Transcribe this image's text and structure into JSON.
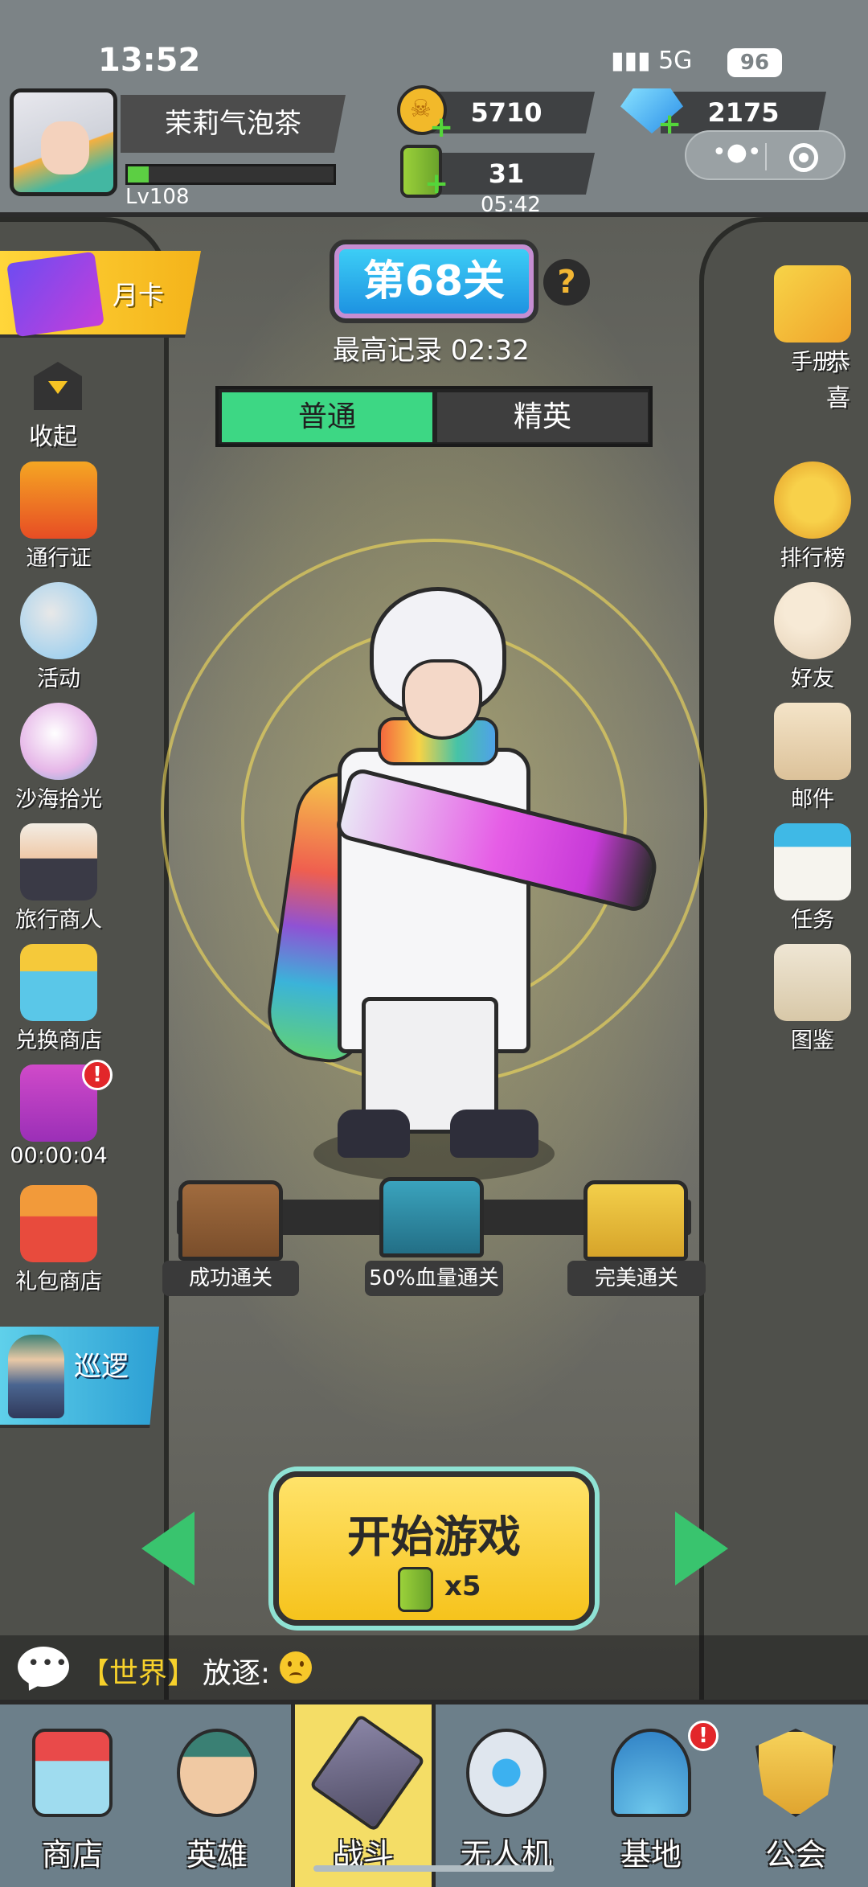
{
  "status_bar": {
    "time": "13:52",
    "network": "5G",
    "battery": "96"
  },
  "player": {
    "name": "茉莉气泡茶",
    "level": "Lv108",
    "xp_fraction": 0.1
  },
  "resources": {
    "gold": "5710",
    "gems": "2175",
    "stamina": "31",
    "stamina_timer": "05:42"
  },
  "stage": {
    "title": "第68关",
    "help": "?",
    "best_record": "最高记录 02:32",
    "modes": [
      "普通",
      "精英"
    ],
    "active_mode": "普通"
  },
  "left_menu": {
    "month_card": "月卡",
    "collapse": "收起",
    "items": [
      {
        "label": "通行证",
        "icon": "gift-box-icon"
      },
      {
        "label": "活动",
        "icon": "megaphone-icon"
      },
      {
        "label": "沙海拾光",
        "icon": "pearl-icon"
      },
      {
        "label": "旅行商人",
        "icon": "merchant-icon"
      },
      {
        "label": "兑换商店",
        "icon": "shop-icon"
      },
      {
        "label": "00:00:04",
        "icon": "timed-gift-icon",
        "badge": "!"
      },
      {
        "label": "礼包商店",
        "icon": "gift-shop-icon"
      }
    ],
    "patrol": "巡逻"
  },
  "right_menu": {
    "items": [
      {
        "label": "手册",
        "icon": "handbook-icon"
      },
      {
        "label": "排行榜",
        "icon": "trophy-icon"
      },
      {
        "label": "好友",
        "icon": "friends-icon"
      },
      {
        "label": "邮件",
        "icon": "mail-icon"
      },
      {
        "label": "任务",
        "icon": "calendar-icon"
      },
      {
        "label": "图鉴",
        "icon": "album-icon"
      }
    ],
    "overlay_text": "恭喜"
  },
  "chests": [
    {
      "label": "成功通关",
      "color": "#8a5a34"
    },
    {
      "label": "50%血量通关",
      "color": "#2f8aa3"
    },
    {
      "label": "完美通关",
      "color": "#e2b93a"
    }
  ],
  "start": {
    "label": "开始游戏",
    "cost": "x5"
  },
  "chat": {
    "channel": "【世界】",
    "message": "放逐:"
  },
  "bottom_nav": {
    "items": [
      {
        "label": "商店",
        "icon": "shop-icon"
      },
      {
        "label": "英雄",
        "icon": "hero-icon"
      },
      {
        "label": "战斗",
        "icon": "rifle-icon",
        "active": true
      },
      {
        "label": "无人机",
        "icon": "drone-icon"
      },
      {
        "label": "基地",
        "icon": "base-dome-icon",
        "badge": "!"
      },
      {
        "label": "公会",
        "icon": "guild-shield-icon"
      }
    ]
  },
  "colors": {
    "accent_green": "#3dd784",
    "gold": "#f6c31c",
    "cyan": "#1b8ee0",
    "alert_red": "#e2262a"
  }
}
